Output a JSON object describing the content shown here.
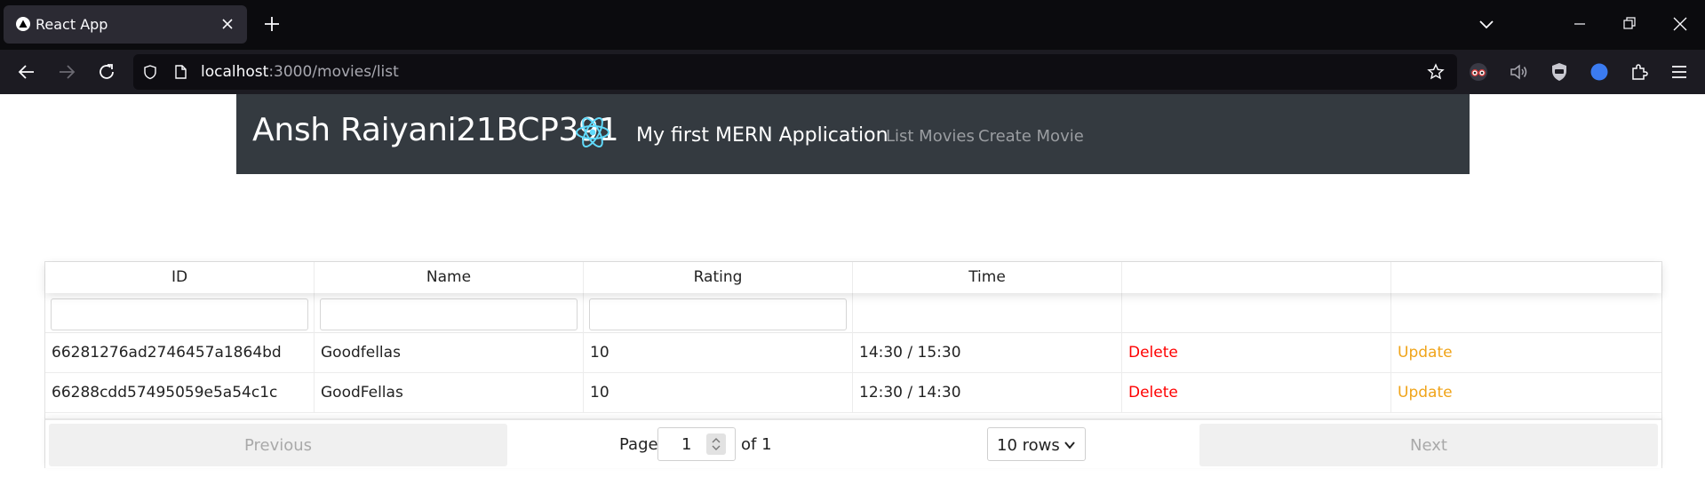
{
  "browser": {
    "tab_title": "React App",
    "url_host": "localhost",
    "url_rest": ":3000/movies/list"
  },
  "header": {
    "brand": "Ansh Raiyani21BCP391",
    "title": "My first MERN Application",
    "links": [
      "List Movies",
      "Create Movie"
    ]
  },
  "table": {
    "columns": [
      "ID",
      "Name",
      "Rating",
      "Time",
      "",
      ""
    ],
    "rows": [
      {
        "id": "66281276ad2746457a1864bd",
        "name": "Goodfellas",
        "rating": "10",
        "time": "14:30 / 15:30",
        "delete": "Delete",
        "update": "Update"
      },
      {
        "id": "66288cdd57495059e5a54c1c",
        "name": "GoodFellas",
        "rating": "10",
        "time": "12:30 / 14:30",
        "delete": "Delete",
        "update": "Update"
      }
    ]
  },
  "pagination": {
    "previous_label": "Previous",
    "next_label": "Next",
    "page_label": "Page",
    "page_value": "1",
    "of_label": "of 1",
    "rows_selected": "10 rows"
  },
  "colors": {
    "header_bg": "#343a40",
    "delete": "#ff0000",
    "update": "#f0a41a"
  }
}
